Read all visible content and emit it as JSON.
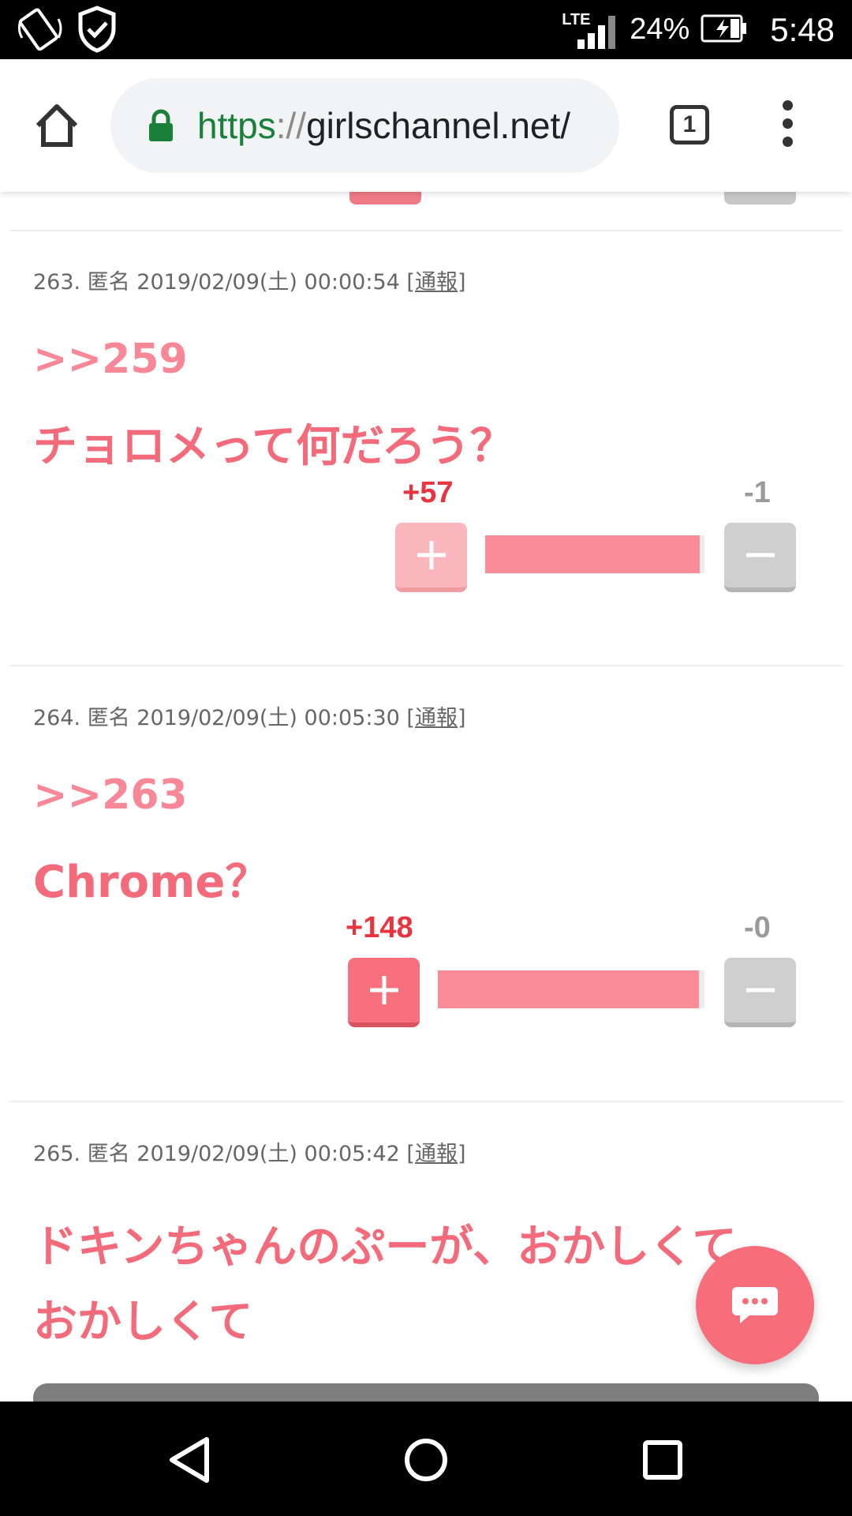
{
  "status_bar": {
    "network": "LTE",
    "battery_percent": "24%",
    "time": "5:48",
    "icons": [
      "screen-rotation-icon",
      "shield-check-icon",
      "signal-icon",
      "battery-charging-icon"
    ]
  },
  "browser": {
    "url_scheme": "https",
    "url_separator": "://",
    "url_host": "girlschannel.net/",
    "tab_count": "1",
    "icons": [
      "home-icon",
      "lock-icon",
      "tabs-icon",
      "more-vert-icon"
    ]
  },
  "comments": [
    {
      "meta": "263. 匿名 2019/02/09(土) 00:00:54",
      "report": "[通報]",
      "anchor": ">>259",
      "text": "チョロメって何だろう？",
      "plus": "+57",
      "minus": "-1",
      "plus_ratio": 0.98
    },
    {
      "meta": "264. 匿名 2019/02/09(土) 00:05:30",
      "report": "[通報]",
      "anchor": ">>263",
      "text": "Chrome？",
      "plus": "+148",
      "minus": "-0",
      "plus_ratio": 0.98
    },
    {
      "meta": "265. 匿名 2019/02/09(土) 00:05:42",
      "report": "[通報]",
      "text_line1": "ドキンちゃんのぷーが、おかしくて",
      "text_line2": "おかしくて"
    }
  ],
  "fab": {
    "icon": "chat-bubble-icon"
  },
  "colors": {
    "accent": "#f36b7a",
    "plus": "#f7707e",
    "minus": "#cfcfcf"
  },
  "nav_bar": {
    "icons": [
      "back-icon",
      "home-circle-icon",
      "recents-icon"
    ]
  }
}
